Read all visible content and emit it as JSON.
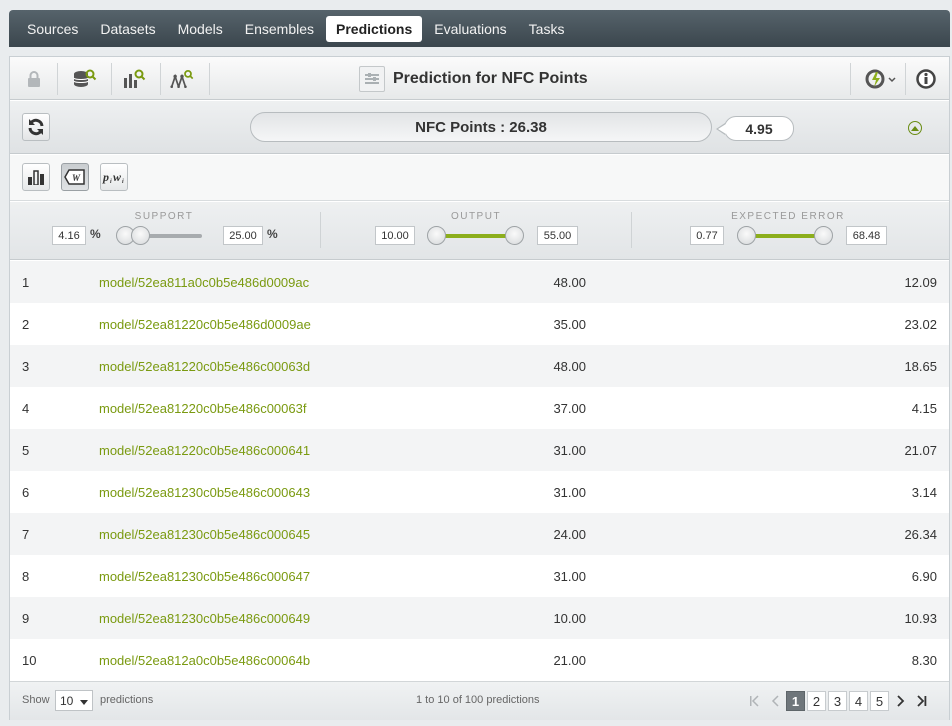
{
  "nav": {
    "tabs": [
      {
        "label": "Sources"
      },
      {
        "label": "Datasets"
      },
      {
        "label": "Models"
      },
      {
        "label": "Ensembles"
      },
      {
        "label": "Predictions",
        "active": true
      },
      {
        "label": "Evaluations"
      },
      {
        "label": "Tasks"
      }
    ]
  },
  "toolbar": {
    "title": "Prediction for NFC Points",
    "icons": [
      "lock-icon",
      "dataset-search-icon",
      "model-search-icon",
      "ensemble-search-icon",
      "actions-icon",
      "info-icon"
    ]
  },
  "prediction": {
    "label": "NFC Points : 26.38",
    "error": "4.95"
  },
  "filters": {
    "support": {
      "label": "SUPPORT",
      "min": "4.16",
      "max": "25.00",
      "unit": "%",
      "low_fraction": 0.0,
      "high_fraction": 0.0
    },
    "output": {
      "label": "OUTPUT",
      "min": "10.00",
      "max": "55.00",
      "low_fraction": 0.0,
      "high_fraction": 1.0
    },
    "expected_error": {
      "label": "EXPECTED ERROR",
      "min": "0.77",
      "max": "68.48",
      "low_fraction": 0.0,
      "high_fraction": 1.0
    }
  },
  "rows": [
    {
      "num": "1",
      "model": "model/52ea811a0c0b5e486d0009ac",
      "output": "48.00",
      "error": "12.09"
    },
    {
      "num": "2",
      "model": "model/52ea81220c0b5e486d0009ae",
      "output": "35.00",
      "error": "23.02"
    },
    {
      "num": "3",
      "model": "model/52ea81220c0b5e486c00063d",
      "output": "48.00",
      "error": "18.65"
    },
    {
      "num": "4",
      "model": "model/52ea81220c0b5e486c00063f",
      "output": "37.00",
      "error": "4.15"
    },
    {
      "num": "5",
      "model": "model/52ea81220c0b5e486c000641",
      "output": "31.00",
      "error": "21.07"
    },
    {
      "num": "6",
      "model": "model/52ea81230c0b5e486c000643",
      "output": "31.00",
      "error": "3.14"
    },
    {
      "num": "7",
      "model": "model/52ea81230c0b5e486c000645",
      "output": "24.00",
      "error": "26.34"
    },
    {
      "num": "8",
      "model": "model/52ea81230c0b5e486c000647",
      "output": "31.00",
      "error": "6.90"
    },
    {
      "num": "9",
      "model": "model/52ea81230c0b5e486c000649",
      "output": "10.00",
      "error": "10.93"
    },
    {
      "num": "10",
      "model": "model/52ea812a0c0b5e486c00064b",
      "output": "21.00",
      "error": "8.30"
    }
  ],
  "footer": {
    "show_label": "Show",
    "show_value": "10",
    "predictions_label": "predictions",
    "range_label": "1 to 10 of 100 predictions",
    "pages": [
      "1",
      "2",
      "3",
      "4",
      "5"
    ],
    "current_page": "1"
  },
  "colors": {
    "accent": "#8cae1c",
    "link": "#7a9a10",
    "nav_bg": "#3b464d"
  }
}
